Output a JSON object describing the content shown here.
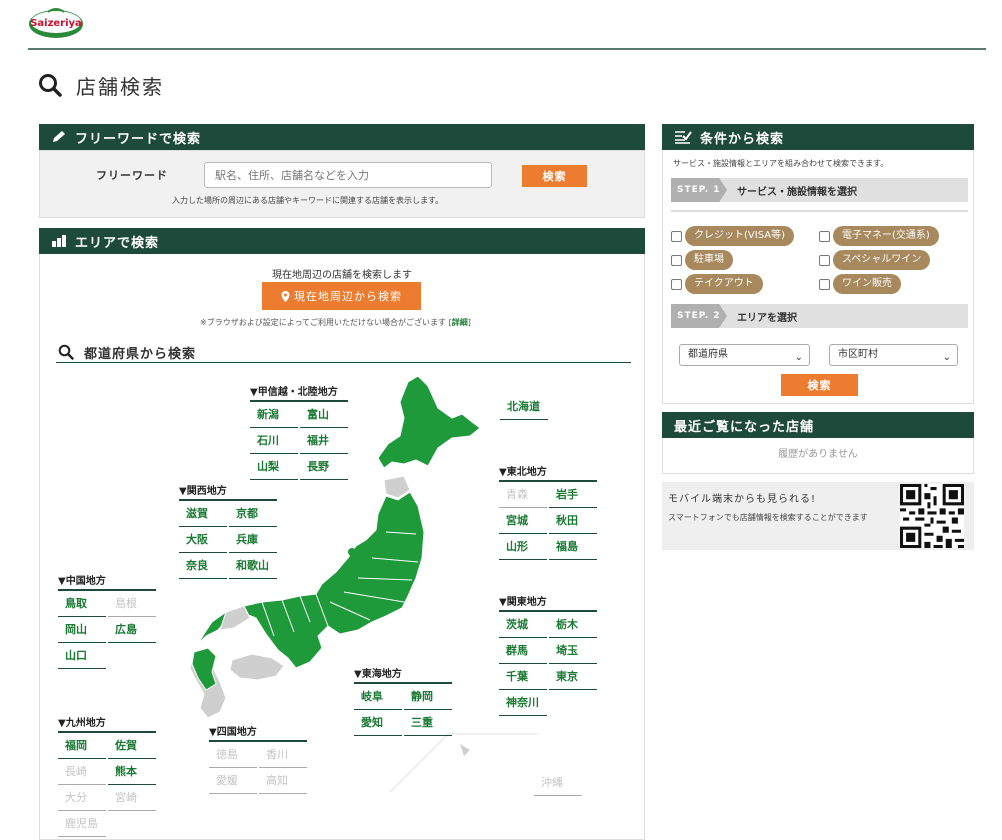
{
  "header": {
    "logo_text": "Saizeriya",
    "page_title": "店舗検索"
  },
  "free_word": {
    "heading": "フリーワードで検索",
    "label": "フリーワード",
    "placeholder": "駅名、住所、店舗名などを入力",
    "button": "検索",
    "note": "入力した場所の周辺にある店舗やキーワードに関連する店舗を表示します。"
  },
  "area": {
    "heading": "エリアで検索",
    "current_text": "現在地周辺の店舗を検索します",
    "current_button": "現在地周辺から検索",
    "note_prefix": "※ブラウザおよび設定によってご利用いただけない場合がございます [",
    "note_link": "詳細",
    "note_suffix": "]",
    "pref_heading": "都道府県から検索"
  },
  "regions": {
    "koshinetsu": {
      "title": "▼甲信越・北陸地方",
      "prefs": [
        {
          "n": "新潟",
          "on": true
        },
        {
          "n": "富山",
          "on": true
        },
        {
          "n": "石川",
          "on": true
        },
        {
          "n": "福井",
          "on": true
        },
        {
          "n": "山梨",
          "on": true
        },
        {
          "n": "長野",
          "on": true
        }
      ]
    },
    "kansai": {
      "title": "▼関西地方",
      "prefs": [
        {
          "n": "滋賀",
          "on": true
        },
        {
          "n": "京都",
          "on": true
        },
        {
          "n": "大阪",
          "on": true
        },
        {
          "n": "兵庫",
          "on": true
        },
        {
          "n": "奈良",
          "on": true
        },
        {
          "n": "和歌山",
          "on": true
        }
      ]
    },
    "chugoku": {
      "title": "▼中国地方",
      "prefs": [
        {
          "n": "鳥取",
          "on": true
        },
        {
          "n": "島根",
          "on": false
        },
        {
          "n": "岡山",
          "on": true
        },
        {
          "n": "広島",
          "on": true
        },
        {
          "n": "山口",
          "on": true
        }
      ]
    },
    "kyushu": {
      "title": "▼九州地方",
      "prefs": [
        {
          "n": "福岡",
          "on": true
        },
        {
          "n": "佐賀",
          "on": true
        },
        {
          "n": "長崎",
          "on": false
        },
        {
          "n": "熊本",
          "on": true
        },
        {
          "n": "大分",
          "on": false
        },
        {
          "n": "宮崎",
          "on": false
        },
        {
          "n": "鹿児島",
          "on": false
        }
      ]
    },
    "shikoku": {
      "title": "▼四国地方",
      "prefs": [
        {
          "n": "徳島",
          "on": false
        },
        {
          "n": "香川",
          "on": false
        },
        {
          "n": "愛媛",
          "on": false
        },
        {
          "n": "高知",
          "on": false
        }
      ]
    },
    "tokai": {
      "title": "▼東海地方",
      "prefs": [
        {
          "n": "岐阜",
          "on": true
        },
        {
          "n": "静岡",
          "on": true
        },
        {
          "n": "愛知",
          "on": true
        },
        {
          "n": "三重",
          "on": true
        }
      ]
    },
    "tohoku": {
      "title": "▼東北地方",
      "prefs": [
        {
          "n": "青森",
          "on": false
        },
        {
          "n": "岩手",
          "on": true
        },
        {
          "n": "宮城",
          "on": true
        },
        {
          "n": "秋田",
          "on": true
        },
        {
          "n": "山形",
          "on": true
        },
        {
          "n": "福島",
          "on": true
        }
      ]
    },
    "kanto": {
      "title": "▼関東地方",
      "prefs": [
        {
          "n": "茨城",
          "on": true
        },
        {
          "n": "栃木",
          "on": true
        },
        {
          "n": "群馬",
          "on": true
        },
        {
          "n": "埼玉",
          "on": true
        },
        {
          "n": "千葉",
          "on": true
        },
        {
          "n": "東京",
          "on": true
        },
        {
          "n": "神奈川",
          "on": true
        }
      ]
    },
    "hokkaido": {
      "title": "",
      "prefs": [
        {
          "n": "北海道",
          "on": true
        }
      ]
    },
    "okinawa": {
      "title": "",
      "prefs": [
        {
          "n": "沖縄",
          "on": false
        }
      ]
    }
  },
  "conditions": {
    "heading": "条件から検索",
    "desc": "サービス・施設情報とエリアを組み合わせて検索できます。",
    "step1_label": "STEP. 1",
    "step1_text": "サービス・施設情報を選択",
    "options": [
      "クレジット(VISA等)",
      "電子マネー(交通系)",
      "駐車場",
      "スペシャルワイン",
      "テイクアウト",
      "ワイン販売"
    ],
    "step2_label": "STEP. 2",
    "step2_text": "エリアを選択",
    "pref_select": "都道府県",
    "city_select": "市区町村",
    "button": "検索"
  },
  "recent": {
    "heading": "最近ご覧になった店舗",
    "empty": "履歴がありません"
  },
  "mobile": {
    "title": "モバイル端末からも見られる!",
    "desc": "スマートフォンでも店舗情報を検索することができます"
  },
  "colors": {
    "panel_header": "#1d4a3b",
    "button": "#ee7c30",
    "pill": "#a8895e",
    "map_active": "#1e9a3a",
    "map_inactive": "#cfcfcf"
  }
}
